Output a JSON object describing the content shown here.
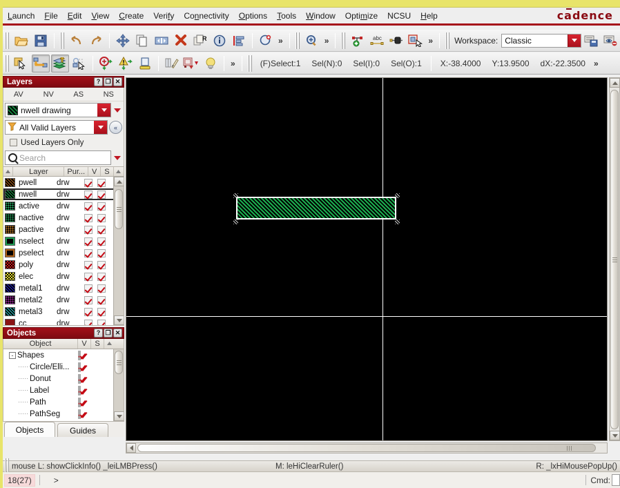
{
  "app": {
    "brand": "cadence",
    "menus": [
      {
        "label": "Launch",
        "mnemonic": "L"
      },
      {
        "label": "File",
        "mnemonic": "F"
      },
      {
        "label": "Edit",
        "mnemonic": "E"
      },
      {
        "label": "View",
        "mnemonic": "V"
      },
      {
        "label": "Create",
        "mnemonic": "C"
      },
      {
        "label": "Verify",
        "mnemonic": "f"
      },
      {
        "label": "Connectivity",
        "mnemonic": "n"
      },
      {
        "label": "Options",
        "mnemonic": "O"
      },
      {
        "label": "Tools",
        "mnemonic": "T"
      },
      {
        "label": "Window",
        "mnemonic": "W"
      },
      {
        "label": "Optimize",
        "mnemonic": "m"
      },
      {
        "label": "NCSU",
        "mnemonic": ""
      },
      {
        "label": "Help",
        "mnemonic": "H"
      }
    ]
  },
  "toolbar1": {
    "items": [
      {
        "name": "open-icon",
        "tip": "Open"
      },
      {
        "name": "save-icon",
        "tip": "Save"
      },
      {
        "name": "undo-icon",
        "tip": "Undo"
      },
      {
        "name": "redo-icon",
        "tip": "Redo"
      },
      {
        "name": "move-icon",
        "tip": "Move"
      },
      {
        "name": "copy-icon",
        "tip": "Copy"
      },
      {
        "name": "stretch-icon",
        "tip": "Stretch"
      },
      {
        "name": "delete-icon",
        "tip": "Delete"
      },
      {
        "name": "properties-icon",
        "tip": "Properties"
      },
      {
        "name": "info-icon",
        "tip": "Info"
      },
      {
        "name": "align-icon",
        "tip": "Align"
      },
      {
        "name": "zoom-fit-icon",
        "tip": "Fit"
      },
      {
        "name": "zoom-in-icon",
        "tip": "Zoom In"
      }
    ],
    "overflow_label": "»",
    "workspace_label": "Workspace:",
    "workspace_value": "Classic",
    "workspace_buttons": [
      {
        "name": "save-workspace-icon"
      },
      {
        "name": "delete-workspace-icon"
      }
    ]
  },
  "toolbar2": {
    "items": [
      {
        "name": "select-rect-icon",
        "pressed": false
      },
      {
        "name": "route-wire-icon",
        "pressed": true
      },
      {
        "name": "layer-stack-icon",
        "pressed": true
      },
      {
        "name": "select-shapes-icon",
        "pressed": false
      },
      {
        "name": "stop-icon",
        "pressed": false
      },
      {
        "name": "warning-icon",
        "pressed": false
      },
      {
        "name": "ruler-icon",
        "pressed": false
      },
      {
        "name": "measure-icon",
        "pressed": false
      },
      {
        "name": "palette-icon",
        "pressed": false
      },
      {
        "name": "lightbulb-icon",
        "pressed": false
      }
    ],
    "overflow_label": "»",
    "status": {
      "select": "(F)Select:1",
      "sel_n": "Sel(N):0",
      "sel_i": "Sel(I):0",
      "sel_o": "Sel(O):1",
      "x": "X:-38.4000",
      "y": "Y:13.9500",
      "dx": "dX:-22.3500",
      "more": "»"
    }
  },
  "layers_panel": {
    "title": "Layers",
    "window_buttons": [
      {
        "name": "help-button",
        "label": "?"
      },
      {
        "name": "undock-button",
        "label": "❐"
      },
      {
        "name": "close-button",
        "label": "✕"
      }
    ],
    "visibility_columns": [
      "AV",
      "NV",
      "AS",
      "NS"
    ],
    "current_layer": "nwell drawing",
    "current_layer_color": "#19a34a",
    "filter_value": "All Valid Layers",
    "used_layers_only_label": "Used Layers Only",
    "used_layers_only_checked": false,
    "search_placeholder": "Search",
    "columns": [
      "Layer",
      "Pur...",
      "V",
      "S"
    ],
    "rows": [
      {
        "layer": "pwell",
        "purpose": "drw",
        "v": true,
        "s": true,
        "color": "#b4651a",
        "pattern": "diagonal",
        "selected": false
      },
      {
        "layer": "nwell",
        "purpose": "drw",
        "v": true,
        "s": true,
        "color": "#19a34a",
        "pattern": "diagonal",
        "selected": true
      },
      {
        "layer": "active",
        "purpose": "drw",
        "v": true,
        "s": true,
        "color": "#2fcf7a",
        "pattern": "dots",
        "selected": false
      },
      {
        "layer": "nactive",
        "purpose": "drw",
        "v": true,
        "s": true,
        "color": "#2cbd6d",
        "pattern": "dots",
        "selected": false
      },
      {
        "layer": "pactive",
        "purpose": "drw",
        "v": true,
        "s": true,
        "color": "#e8922e",
        "pattern": "dots",
        "selected": false
      },
      {
        "layer": "nselect",
        "purpose": "drw",
        "v": true,
        "s": true,
        "color": "#1f9e55",
        "pattern": "outline",
        "selected": false
      },
      {
        "layer": "pselect",
        "purpose": "drw",
        "v": true,
        "s": true,
        "color": "#b4651a",
        "pattern": "outline",
        "selected": false
      },
      {
        "layer": "poly",
        "purpose": "drw",
        "v": true,
        "s": true,
        "color": "#d21a1a",
        "pattern": "checker",
        "selected": false
      },
      {
        "layer": "elec",
        "purpose": "drw",
        "v": true,
        "s": true,
        "color": "#e8e030",
        "pattern": "checker",
        "selected": false
      },
      {
        "layer": "metal1",
        "purpose": "drw",
        "v": true,
        "s": true,
        "color": "#2222c8",
        "pattern": "diagonal",
        "selected": false
      },
      {
        "layer": "metal2",
        "purpose": "drw",
        "v": true,
        "s": true,
        "color": "#c02ec0",
        "pattern": "dots",
        "selected": false
      },
      {
        "layer": "metal3",
        "purpose": "drw",
        "v": true,
        "s": true,
        "color": "#2fd0d0",
        "pattern": "diagonal",
        "selected": false
      },
      {
        "layer": "cc",
        "purpose": "drw",
        "v": true,
        "s": true,
        "color": "#8a1414",
        "pattern": "solid",
        "selected": false
      }
    ]
  },
  "objects_panel": {
    "title": "Objects",
    "window_buttons": [
      {
        "name": "help-button",
        "label": "?"
      },
      {
        "name": "undock-button",
        "label": "❐"
      },
      {
        "name": "close-button",
        "label": "✕"
      }
    ],
    "columns": [
      "Object",
      "V",
      "S"
    ],
    "rows": [
      {
        "label": "Shapes",
        "level": 0,
        "expander": "-",
        "v": true,
        "s": true
      },
      {
        "label": "Circle/Elli...",
        "level": 1,
        "expander": "",
        "v": true,
        "s": true
      },
      {
        "label": "Donut",
        "level": 1,
        "expander": "",
        "v": true,
        "s": true
      },
      {
        "label": "Label",
        "level": 1,
        "expander": "",
        "v": true,
        "s": true
      },
      {
        "label": "Path",
        "level": 1,
        "expander": "",
        "v": true,
        "s": true
      },
      {
        "label": "PathSeg",
        "level": 1,
        "expander": "",
        "v": true,
        "s": true
      }
    ],
    "tabs": [
      {
        "label": "Objects",
        "active": true
      },
      {
        "label": "Guides",
        "active": false
      }
    ]
  },
  "canvas": {
    "background_color": "#000000",
    "axis_color": "#ffffff",
    "shape": {
      "layer": "nwell drawing",
      "fill_color": "#19a34a",
      "selected": true,
      "selection_color": "#ffffff"
    }
  },
  "status_bar": {
    "mouse_left": "mouse L: showClickInfo() _leiLMBPress()",
    "mouse_middle": "M: leHiClearRuler()",
    "mouse_right": "R: _lxHiMousePopUp()"
  },
  "command_bar": {
    "count": "18(27)",
    "prompt": ">",
    "cmd_label": "Cmd:",
    "cmd_value": ""
  }
}
